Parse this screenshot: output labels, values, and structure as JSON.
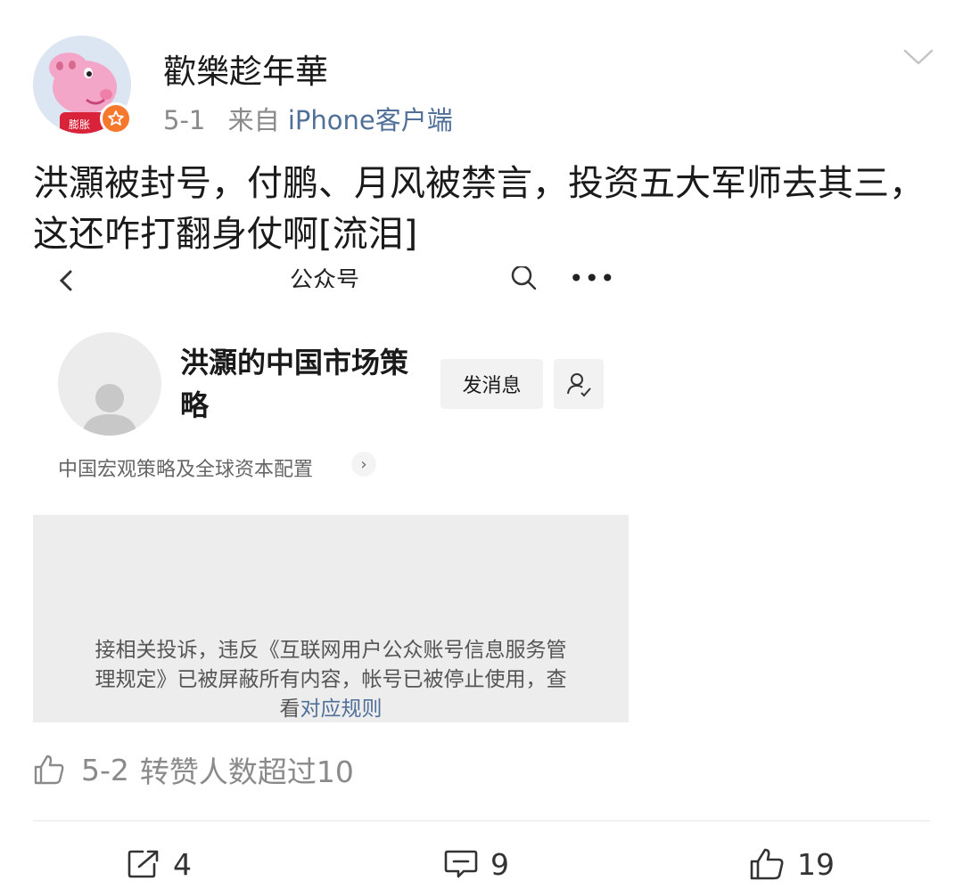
{
  "post": {
    "username": "歡樂趁年華",
    "date": "5-1",
    "source_prefix": "来自",
    "source_app": "iPhone客户端",
    "avatar_tag": "膨胀",
    "text": "洪灝被封号，付鹏、月风被禁言，投资五大军师去其三，这还咋打翻身仗啊[流泪]"
  },
  "embedded_screenshot": {
    "nav_title": "公众号",
    "account_name": "洪灝的中国市场策略",
    "message_button": "发消息",
    "description": "中国宏观策略及全球资本配置",
    "description_arrow": "›",
    "blocked_notice": "接相关投诉，违反《互联网用户公众账号信息服务管理规定》已被屏蔽所有内容，帐号已被停止使用，查看",
    "blocked_link": "对应规则",
    "more_glyph": "•••"
  },
  "forward_info": {
    "date": "5-2",
    "text": "转赞人数超过10"
  },
  "actions": {
    "share_count": "4",
    "comment_count": "9",
    "like_count": "19"
  },
  "colors": {
    "link": "#50709a",
    "meta_gray": "#8a8a8a",
    "badge_orange": "#f5782c",
    "panel_gray": "#ededed"
  },
  "icons": {
    "avatar": "peppa-pig-avatar",
    "badge": "vip-star-badge",
    "chevron": "chevron-down-icon",
    "share": "share-icon",
    "comment": "comment-icon",
    "like": "thumbs-up-icon"
  }
}
